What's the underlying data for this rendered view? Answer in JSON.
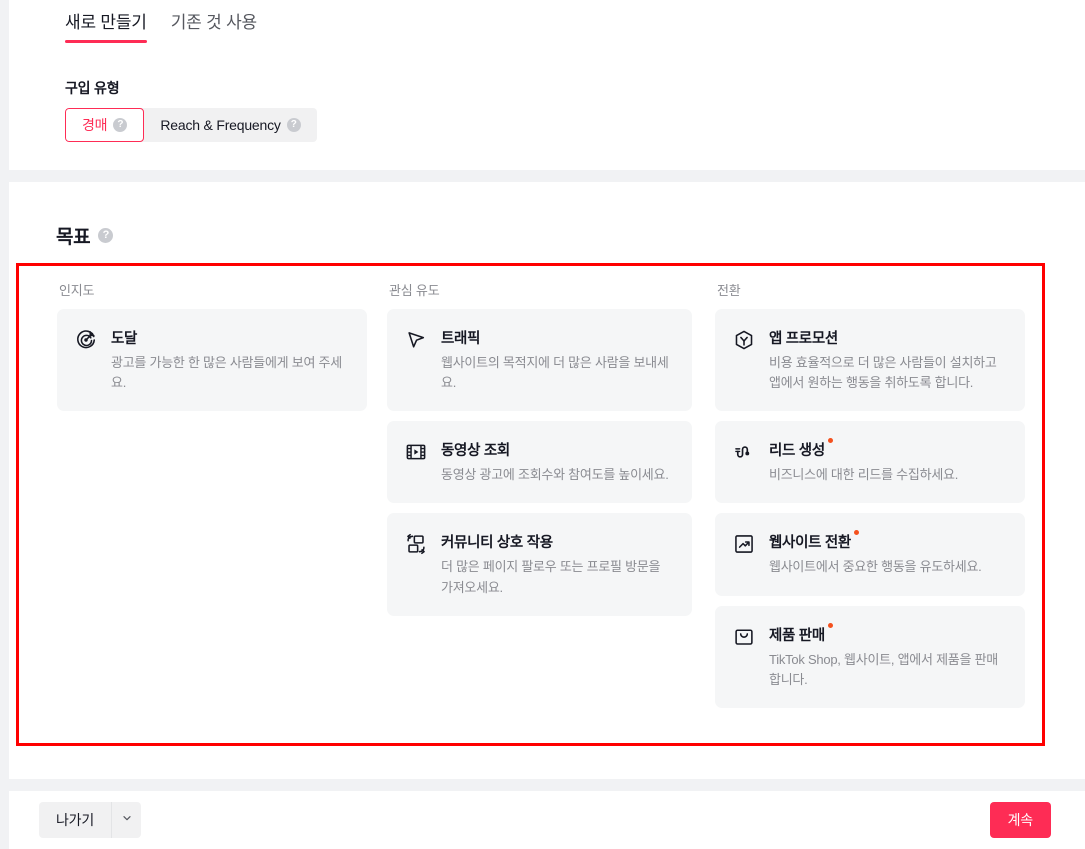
{
  "tabs": [
    {
      "label": "새로 만들기",
      "active": true
    },
    {
      "label": "기존 것 사용",
      "active": false
    }
  ],
  "purchase_type": {
    "label": "구입 유형",
    "options": [
      {
        "label": "경매",
        "active": true,
        "help": "?"
      },
      {
        "label": "Reach & Frequency",
        "active": false,
        "help": "?"
      }
    ]
  },
  "objective": {
    "title": "목표",
    "help": "?",
    "columns": [
      {
        "header": "인지도",
        "cards": [
          {
            "icon": "target-icon",
            "title": "도달",
            "desc": "광고를 가능한 한 많은 사람들에게 보여 주세요.",
            "new": false
          }
        ]
      },
      {
        "header": "관심 유도",
        "cards": [
          {
            "icon": "cursor-arrow-icon",
            "title": "트래픽",
            "desc": "웹사이트의 목적지에 더 많은 사람을 보내세요.",
            "new": false
          },
          {
            "icon": "video-film-icon",
            "title": "동영상 조회",
            "desc": "동영상 광고에 조회수와 참여도를 높이세요.",
            "new": false
          },
          {
            "icon": "community-interaction-icon",
            "title": "커뮤니티 상호 작용",
            "desc": "더 많은 페이지 팔로우 또는 프로필 방문을 가져오세요.",
            "new": false
          }
        ]
      },
      {
        "header": "전환",
        "cards": [
          {
            "icon": "app-cube-icon",
            "title": "앱 프로모션",
            "desc": "비용 효율적으로 더 많은 사람들이 설치하고 앱에서 원하는 행동을 취하도록 합니다.",
            "new": false
          },
          {
            "icon": "lead-magnet-icon",
            "title": "리드 생성",
            "desc": "비즈니스에 대한 리드를 수집하세요.",
            "new": true
          },
          {
            "icon": "trend-up-icon",
            "title": "웹사이트 전환",
            "desc": "웹사이트에서 중요한 행동을 유도하세요.",
            "new": true
          },
          {
            "icon": "shopping-bag-icon",
            "title": "제품 판매",
            "desc": "TikTok Shop, 웹사이트, 앱에서 제품을 판매합니다.",
            "new": true
          }
        ]
      }
    ]
  },
  "footer": {
    "exit_label": "나가기",
    "continue_label": "계속"
  },
  "colors": {
    "accent": "#fe2c55",
    "highlight_box": "#ff0000",
    "new_dot": "#f4511e",
    "card_bg": "#f5f6f7",
    "page_bg": "#f1f2f4"
  }
}
